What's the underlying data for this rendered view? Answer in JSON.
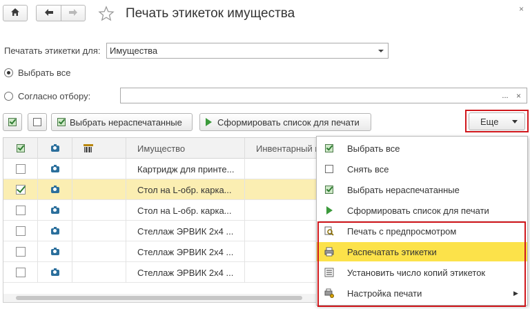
{
  "window": {
    "title": "Печать этикеток имущества",
    "close_glyph": "×"
  },
  "nav": {
    "home_icon": "home-icon",
    "back_icon": "arrow-left-icon",
    "forward_icon": "arrow-right-icon",
    "favorite_icon": "star-icon"
  },
  "form": {
    "print_for_label": "Печатать этикетки для:",
    "print_for_value": "Имущества",
    "select_all_label": "Выбрать все",
    "by_filter_label": "Согласно отбору:",
    "filter_value": "",
    "filter_button": "...",
    "selected_option": "select_all"
  },
  "toolbar": {
    "select_unprinted": "Выбрать нераспечатанные",
    "build_list": "Сформировать список для печати",
    "more": "Еще"
  },
  "table": {
    "columns": [
      "",
      "",
      "",
      "Имущество",
      "Инвентарный н"
    ],
    "rows": [
      {
        "checked": false,
        "name": "Картридж для принте...",
        "selected": false
      },
      {
        "checked": true,
        "name": "Стол на L-обр. карка...",
        "selected": true
      },
      {
        "checked": false,
        "name": "Стол на L-обр. карка...",
        "selected": false
      },
      {
        "checked": false,
        "name": "Стеллаж ЭРВИК 2х4 ...",
        "selected": false
      },
      {
        "checked": false,
        "name": "Стеллаж ЭРВИК 2х4 ...",
        "selected": false
      },
      {
        "checked": false,
        "name": "Стеллаж ЭРВИК 2х4 ...",
        "selected": false
      }
    ]
  },
  "menu": {
    "items": [
      {
        "label": "Выбрать все",
        "icon": "check-all-icon"
      },
      {
        "label": "Снять все",
        "icon": "uncheck-all-icon"
      },
      {
        "label": "Выбрать нераспечатанные",
        "icon": "select-unprinted-icon"
      },
      {
        "label": "Сформировать список для печати",
        "icon": "play-icon"
      },
      {
        "label": "Печать с предпросмотром",
        "icon": "print-preview-icon"
      },
      {
        "label": "Распечатать этикетки",
        "icon": "printer-icon"
      },
      {
        "label": "Установить число копий этикеток",
        "icon": "copies-icon"
      },
      {
        "label": "Настройка печати",
        "icon": "print-settings-icon"
      }
    ],
    "highlighted_index": 5,
    "submenu_arrow": "▶"
  },
  "colors": {
    "highlight": "#fce24a",
    "selected_row": "#fbeeb2",
    "annotation_red": "#d0161b"
  }
}
